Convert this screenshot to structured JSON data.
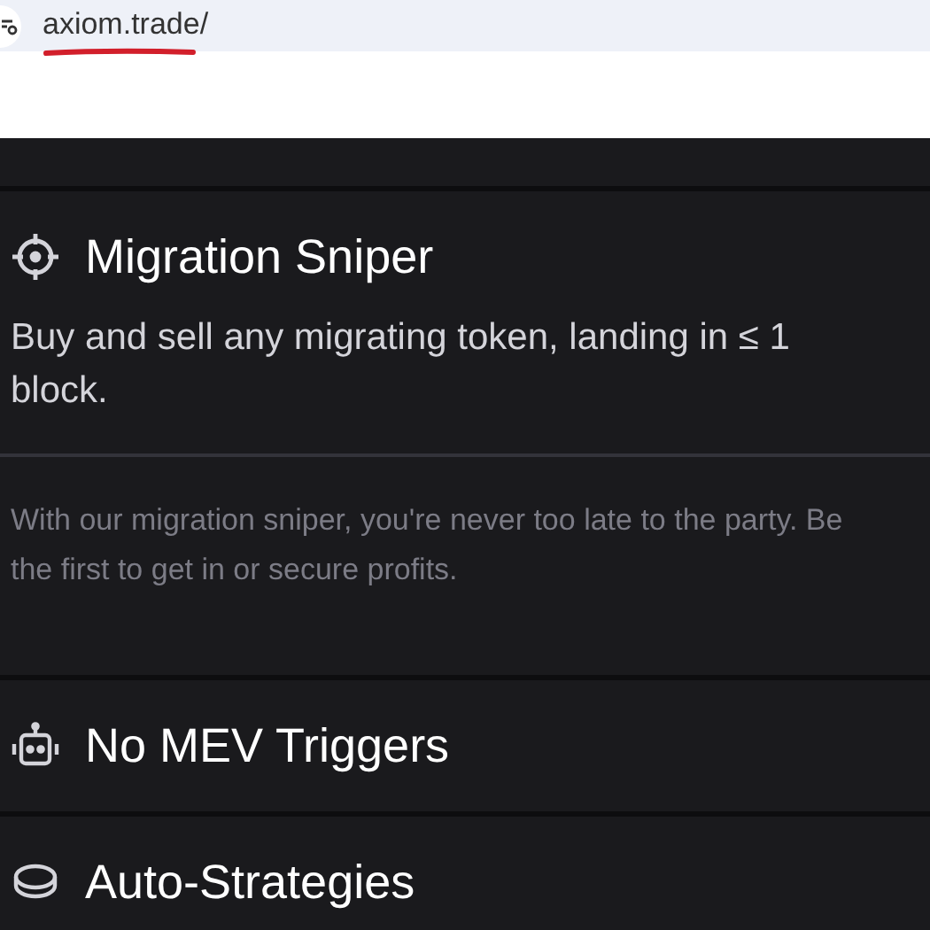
{
  "address_bar": {
    "url": "axiom.trade/"
  },
  "features": [
    {
      "title": "Migration Sniper",
      "expanded": true,
      "description": "Buy and sell any migrating token, landing in ≤ 1 block.",
      "detail": "With our migration sniper, you're never too late to the party. Be the first to get in or secure profits."
    },
    {
      "title": "No MEV Triggers",
      "expanded": false
    },
    {
      "title": "Auto-Strategies",
      "expanded": false
    }
  ]
}
